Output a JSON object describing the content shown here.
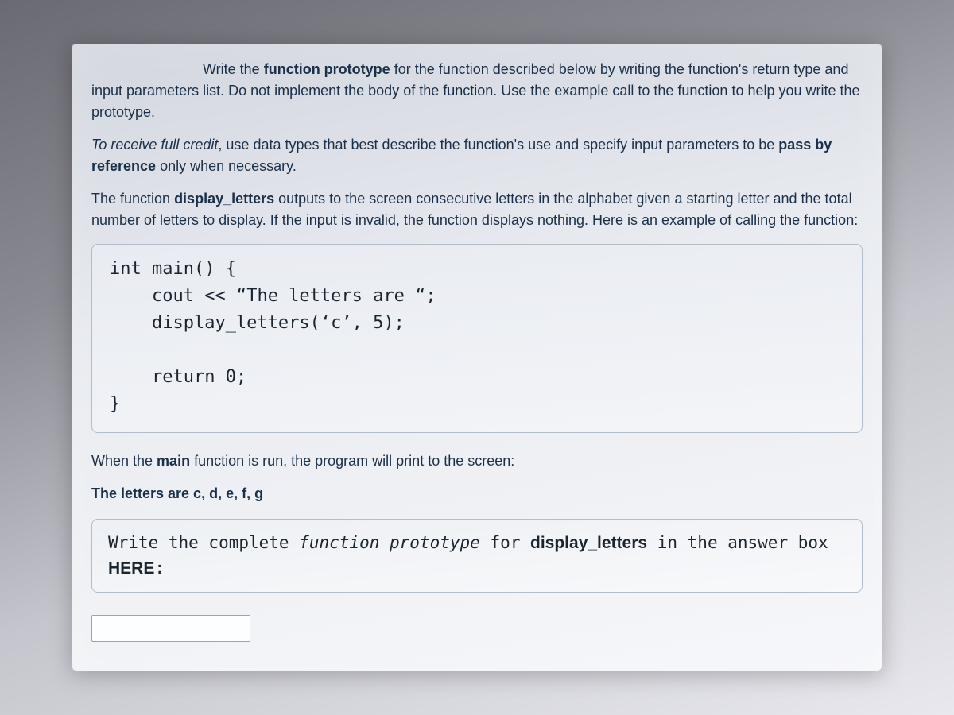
{
  "paragraphs": {
    "p1_pre": "Write the ",
    "p1_b1": "function prototype",
    "p1_mid": " for the function described below by writing the function's return type and input parameters list. Do not implement the body of the function. Use the example call to the function to help you write the prototype.",
    "p2_i1": "To receive full credit",
    "p2_mid1": ", use data types that best describe the function's use and specify input parameters to be ",
    "p2_b1": "pass by reference",
    "p2_mid2": " only when necessary.",
    "p3_pre": "The function ",
    "p3_b1": "display_letters",
    "p3_mid": " outputs to the screen consecutive letters in the alphabet given a starting letter and the total number of letters to display. If the input is invalid, the function displays nothing.  Here is an example of calling the function:",
    "p4_pre": "When the ",
    "p4_b1": "main",
    "p4_mid": " function is run, the program will print to the screen:",
    "p5": "The letters are c, d, e, f, g"
  },
  "code": {
    "l1": "int main() {",
    "l2a": "    cout << ",
    "l2b": "“The letters are “",
    "l2c": ";",
    "l3a": "    display_letters(",
    "l3b": "‘c’",
    "l3c": ", 5);",
    "l4": "",
    "l5": "    return 0;",
    "l6": "}"
  },
  "prompt": {
    "t1": "Write the complete ",
    "t2": "function prototype",
    "t3": " for ",
    "t4": "display_letters",
    "t5": " in the answer box ",
    "t6": "HERE",
    "t7": ":"
  },
  "answer": {
    "value": "",
    "placeholder": ""
  }
}
